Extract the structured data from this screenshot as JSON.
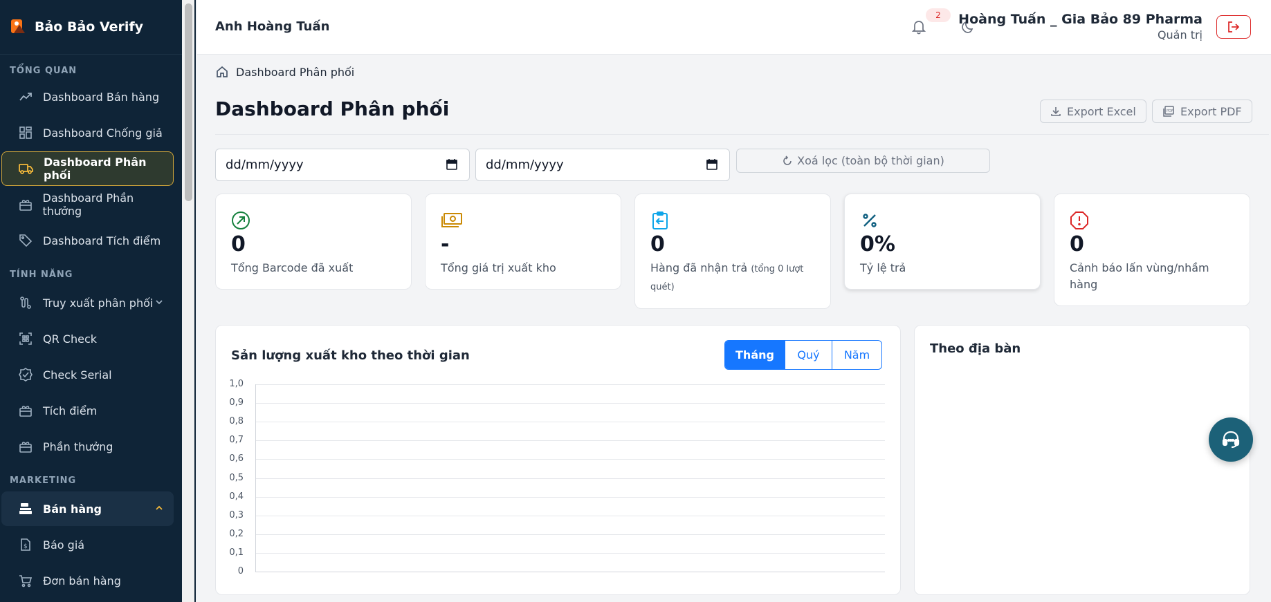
{
  "brand": {
    "name": "Bảo Bảo Verify"
  },
  "sidebar": {
    "sections": [
      {
        "title": "TỔNG QUAN"
      },
      {
        "title": "TÍNH NĂNG"
      },
      {
        "title": "MARKETING"
      }
    ],
    "items": [
      {
        "label": "Dashboard Bán hàng",
        "icon": "trending-up-icon"
      },
      {
        "label": "Dashboard Chống giả",
        "icon": "grid-icon"
      },
      {
        "label": "Dashboard Phân phối",
        "icon": "truck-icon",
        "active": true
      },
      {
        "label": "Dashboard Phần thưởng",
        "icon": "gift-icon"
      },
      {
        "label": "Dashboard Tích điểm",
        "icon": "tag-icon"
      },
      {
        "label": "Truy xuất phân phối",
        "icon": "route-icon",
        "expandable": true
      },
      {
        "label": "QR Check",
        "icon": "qr-scan-icon"
      },
      {
        "label": "Check Serial",
        "icon": "badge-check-icon"
      },
      {
        "label": "Tích điểm",
        "icon": "gift-icon"
      },
      {
        "label": "Phần thưởng",
        "icon": "gift-icon"
      },
      {
        "label": "Bán hàng",
        "icon": "register-icon",
        "expanded": true
      },
      {
        "label": "Báo giá",
        "icon": "document-dollar-icon"
      },
      {
        "label": "Đơn bán hàng",
        "icon": "cart-icon"
      }
    ]
  },
  "header": {
    "user": "Anh Hoàng Tuấn",
    "notifications": "2",
    "org": "Hoàng Tuấn _ Gia Bảo 89 Pharma",
    "role": "Quản trị"
  },
  "main": {
    "breadcrumb": "Dashboard Phân phối",
    "title": "Dashboard Phân phối",
    "export_excel": "Export Excel",
    "export_pdf": "Export PDF",
    "date_from": "dd/mm/yyyy",
    "date_to": "dd/mm/yyyy",
    "clear_filter": "Xoá lọc (toàn bộ thời gian)",
    "stats": [
      {
        "value": "0",
        "label": "Tổng Barcode đã xuất",
        "icon": "arrow-up-right-circle-icon",
        "color": "#15803d"
      },
      {
        "value": "-",
        "label": "Tổng giá trị xuất kho",
        "icon": "cash-icon",
        "color": "#ca8a04"
      },
      {
        "value": "0",
        "label": "Hàng đã nhận trả",
        "note": "(tổng 0 lượt quét)",
        "icon": "clipboard-return-icon",
        "color": "#0ea5e9"
      },
      {
        "value": "0%",
        "label": "Tỷ lệ trả",
        "icon": "percent-icon",
        "color": "#0f5f80"
      },
      {
        "value": "0",
        "label": "Cảnh báo lấn vùng/nhầm hàng",
        "icon": "alert-octagon-icon",
        "color": "#dc2626"
      }
    ],
    "chart_panel": {
      "title": "Sản lượng xuất kho theo thời gian",
      "tabs": [
        "Tháng",
        "Quý",
        "Năm"
      ],
      "active_tab": "Tháng"
    },
    "region_panel": {
      "title": "Theo địa bàn"
    }
  },
  "chart_data": {
    "type": "line",
    "title": "Sản lượng xuất kho theo thời gian",
    "xlabel": "",
    "ylabel": "",
    "ylim": [
      0,
      1.0
    ],
    "y_ticks": [
      "1,0",
      "0,9",
      "0,8",
      "0,7",
      "0,6",
      "0,5",
      "0,4",
      "0,3",
      "0,2",
      "0,1",
      "0"
    ],
    "grid": true,
    "series": []
  },
  "colors": {
    "sidebar_bg": "#0f2437",
    "accent": "#1677ff",
    "active_border": "#d0a53a",
    "danger": "#dc2626"
  }
}
